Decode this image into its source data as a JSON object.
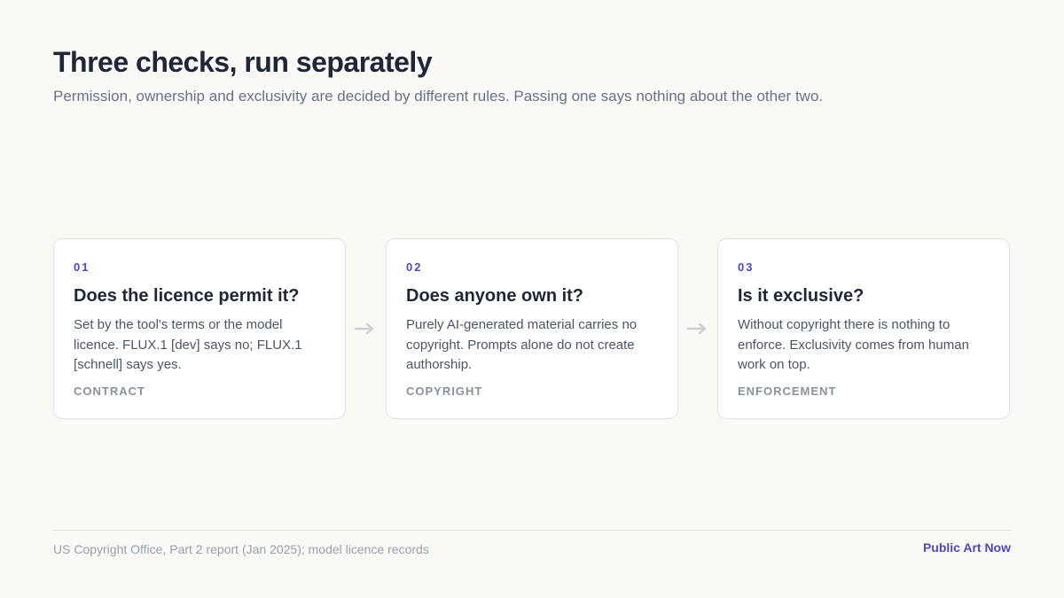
{
  "header": {
    "title": "Three checks, run separately",
    "subtitle": "Permission, ownership and exclusivity are decided by different rules. Passing one says nothing about the other two."
  },
  "steps": [
    {
      "number": "01",
      "title": "Does the licence permit it?",
      "body": "Set by the tool's terms or the model licence. FLUX.1 [dev] says no; FLUX.1 [schnell] says yes.",
      "tag": "CONTRACT"
    },
    {
      "number": "02",
      "title": "Does anyone own it?",
      "body": "Purely AI-generated material carries no copyright. Prompts alone do not create authorship.",
      "tag": "COPYRIGHT"
    },
    {
      "number": "03",
      "title": "Is it exclusive?",
      "body": "Without copyright there is nothing to enforce. Exclusivity comes from human work on top.",
      "tag": "ENFORCEMENT"
    }
  ],
  "arrows": {
    "icon": "arrow-right-icon",
    "color": "#cfcfcf"
  },
  "footer": {
    "source": "US Copyright Office, Part 2 report (Jan 2025); model licence records",
    "brand": "Public Art Now"
  },
  "colors": {
    "accent": "#4f46c8",
    "heading": "#1f2638",
    "background": "#faf9f6"
  }
}
